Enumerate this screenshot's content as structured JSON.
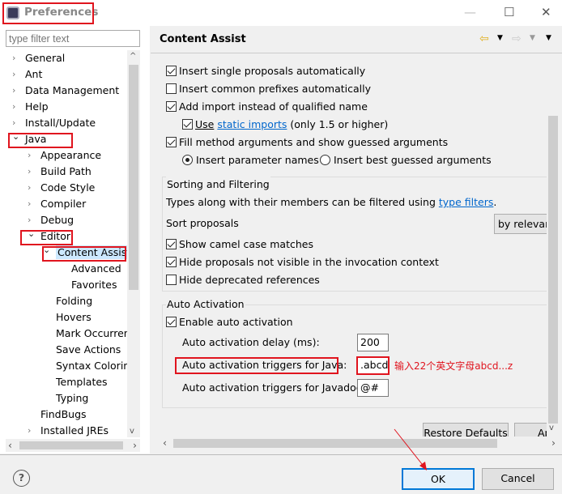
{
  "window": {
    "title": "Preferences",
    "minimize": "—",
    "maximize": "☐",
    "close": "✕"
  },
  "filter": {
    "placeholder": "type filter text"
  },
  "tree": [
    {
      "label": "General",
      "level": 0,
      "chev": "›"
    },
    {
      "label": "Ant",
      "level": 0,
      "chev": "›"
    },
    {
      "label": "Data Management",
      "level": 0,
      "chev": "›"
    },
    {
      "label": "Help",
      "level": 0,
      "chev": "›"
    },
    {
      "label": "Install/Update",
      "level": 0,
      "chev": "›"
    },
    {
      "label": "Java",
      "level": 0,
      "chev": "⌄"
    },
    {
      "label": "Appearance",
      "level": 1,
      "chev": "›"
    },
    {
      "label": "Build Path",
      "level": 1,
      "chev": "›"
    },
    {
      "label": "Code Style",
      "level": 1,
      "chev": "›"
    },
    {
      "label": "Compiler",
      "level": 1,
      "chev": "›"
    },
    {
      "label": "Debug",
      "level": 1,
      "chev": "›"
    },
    {
      "label": "Editor",
      "level": 1,
      "chev": "⌄"
    },
    {
      "label": "Content Assist",
      "level": 2,
      "chev": "⌄",
      "selected": true
    },
    {
      "label": "Advanced",
      "level": 3,
      "chev": ""
    },
    {
      "label": "Favorites",
      "level": 3,
      "chev": ""
    },
    {
      "label": "Folding",
      "level": 2,
      "chev": ""
    },
    {
      "label": "Hovers",
      "level": 2,
      "chev": ""
    },
    {
      "label": "Mark Occurren",
      "level": 2,
      "chev": ""
    },
    {
      "label": "Save Actions",
      "level": 2,
      "chev": ""
    },
    {
      "label": "Syntax Coloring",
      "level": 2,
      "chev": ""
    },
    {
      "label": "Templates",
      "level": 2,
      "chev": ""
    },
    {
      "label": "Typing",
      "level": 2,
      "chev": ""
    },
    {
      "label": "FindBugs",
      "level": 1,
      "chev": ""
    },
    {
      "label": "Installed JREs",
      "level": 1,
      "chev": "›"
    }
  ],
  "page": {
    "title": "Content Assist"
  },
  "insertion": {
    "single": "Insert single proposals automatically",
    "prefixes": "Insert common prefixes automatically",
    "import": "Add import instead of qualified name",
    "use": "Use",
    "static_link": "static imports",
    "static_rest": "(only 1.5 or higher)",
    "fill": "Fill method arguments and show guessed arguments",
    "param_names": "Insert parameter names",
    "best_guess": "Insert best guessed arguments"
  },
  "sorting": {
    "title": "Sorting and Filtering",
    "desc": "Types along with their members can be filtered using ",
    "link": "type filters",
    "desc_end": ".",
    "sort_label": "Sort proposals",
    "sort_value": "by relevan",
    "camel": "Show camel case matches",
    "hide_invisible": "Hide proposals not visible in the invocation context",
    "hide_deprecated": "Hide deprecated references"
  },
  "auto": {
    "title": "Auto Activation",
    "enable": "Enable auto activation",
    "delay_label": "Auto activation delay (ms):",
    "delay_value": "200",
    "java_label": "Auto activation triggers for Java:",
    "java_value": ".abcd",
    "javadoc_label": "Auto activation triggers for Javadoc:",
    "javadoc_value": "@#"
  },
  "annotation": "输入22个英文字母abcd...z",
  "buttons": {
    "restore": "Restore Defaults",
    "apply": "Ap",
    "ok": "OK",
    "cancel": "Cancel",
    "help": "?"
  },
  "colors": {
    "highlight": "#e0141e",
    "link": "#0066cc"
  }
}
